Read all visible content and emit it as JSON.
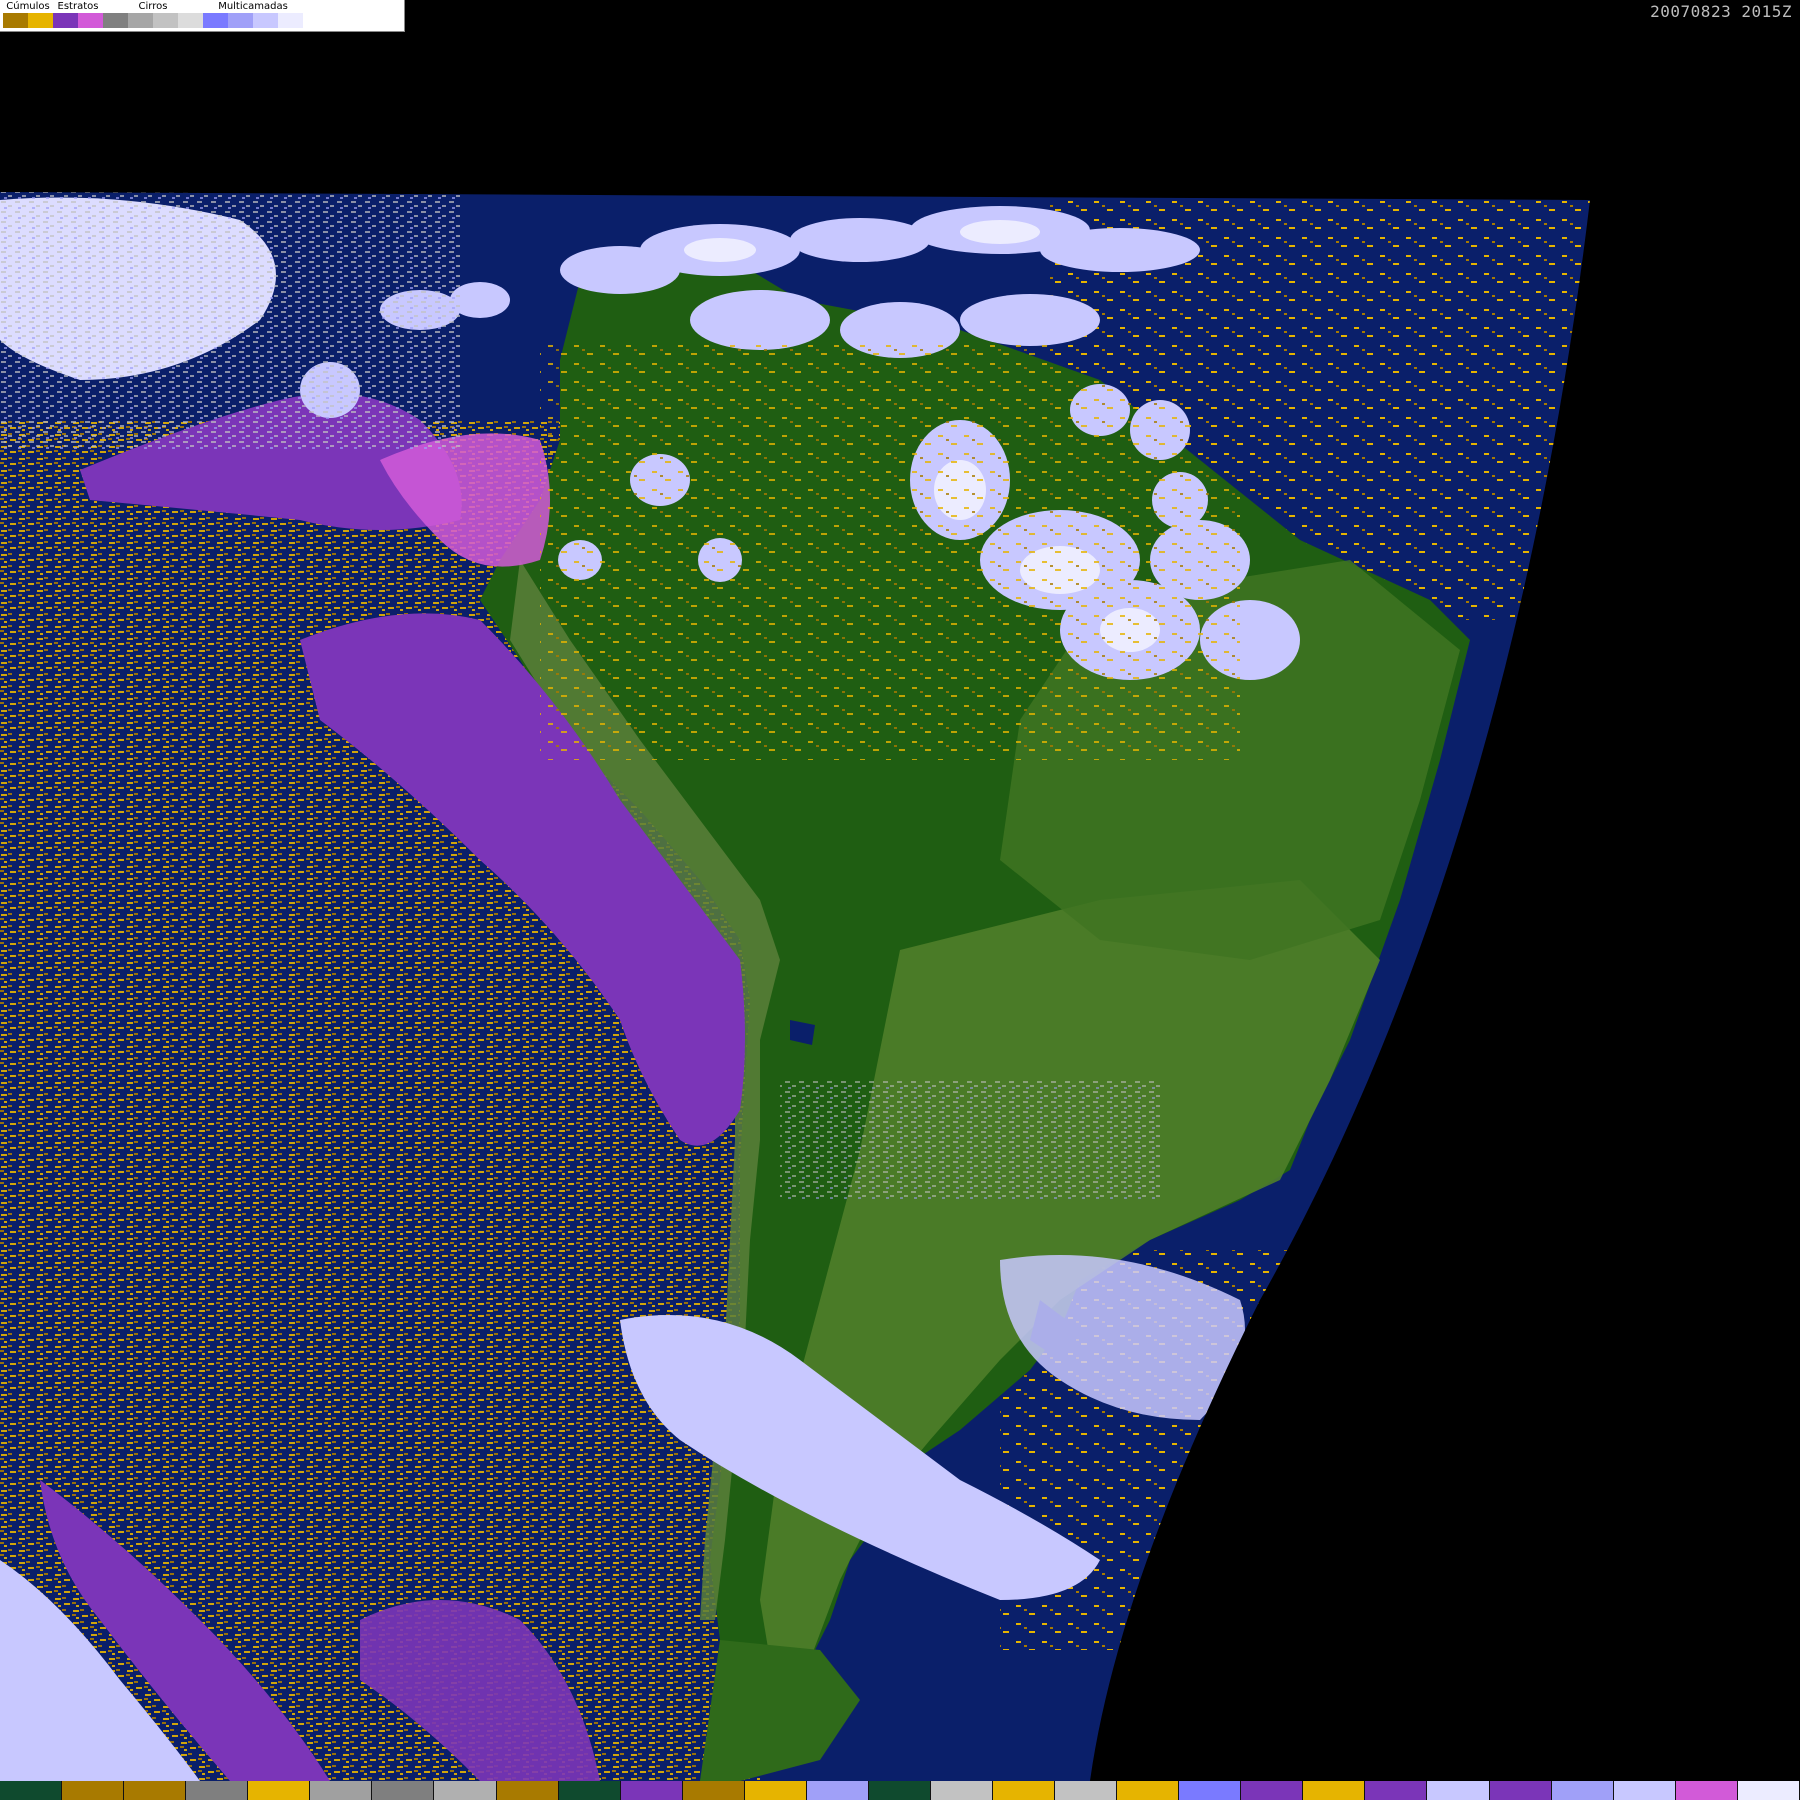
{
  "timestamp": "20070823 2015Z",
  "legend": {
    "groups": [
      {
        "label": "Cúmulos",
        "colors": [
          "#a87a00",
          "#e6b400"
        ]
      },
      {
        "label": "Estratos",
        "colors": [
          "#7b35b8",
          "#d25ad8"
        ]
      },
      {
        "label": "Cirros",
        "colors": [
          "#808080",
          "#a6a6a6",
          "#c2c2c2",
          "#dcdcdc"
        ]
      },
      {
        "label": "Multicamadas",
        "colors": [
          "#7a7aff",
          "#a0a0f8",
          "#c8c8ff",
          "#ececff"
        ]
      }
    ]
  },
  "colors": {
    "ocean": "#0a1f6a",
    "vegetation": "#1f5e12",
    "land_light": "#4f7e2a",
    "space": "#000000"
  },
  "strip_colors": [
    "#0f4a2e",
    "#a87a00",
    "#a87a00",
    "#7f7f7f",
    "#e6b400",
    "#a0a0a0",
    "#7f7f7f",
    "#b0b0b0",
    "#a87a00",
    "#0f4a2e",
    "#7b35b8",
    "#a87a00",
    "#e6b400",
    "#a0a0f8",
    "#0f4a2e",
    "#c2c2c2",
    "#e6b400",
    "#c2c2c2",
    "#e6b400",
    "#7a7aff",
    "#7b35b8",
    "#e6b400",
    "#7b35b8",
    "#c8c8ff",
    "#7b35b8",
    "#a0a0f8",
    "#c8c8ff",
    "#d25ad8",
    "#ececff"
  ]
}
